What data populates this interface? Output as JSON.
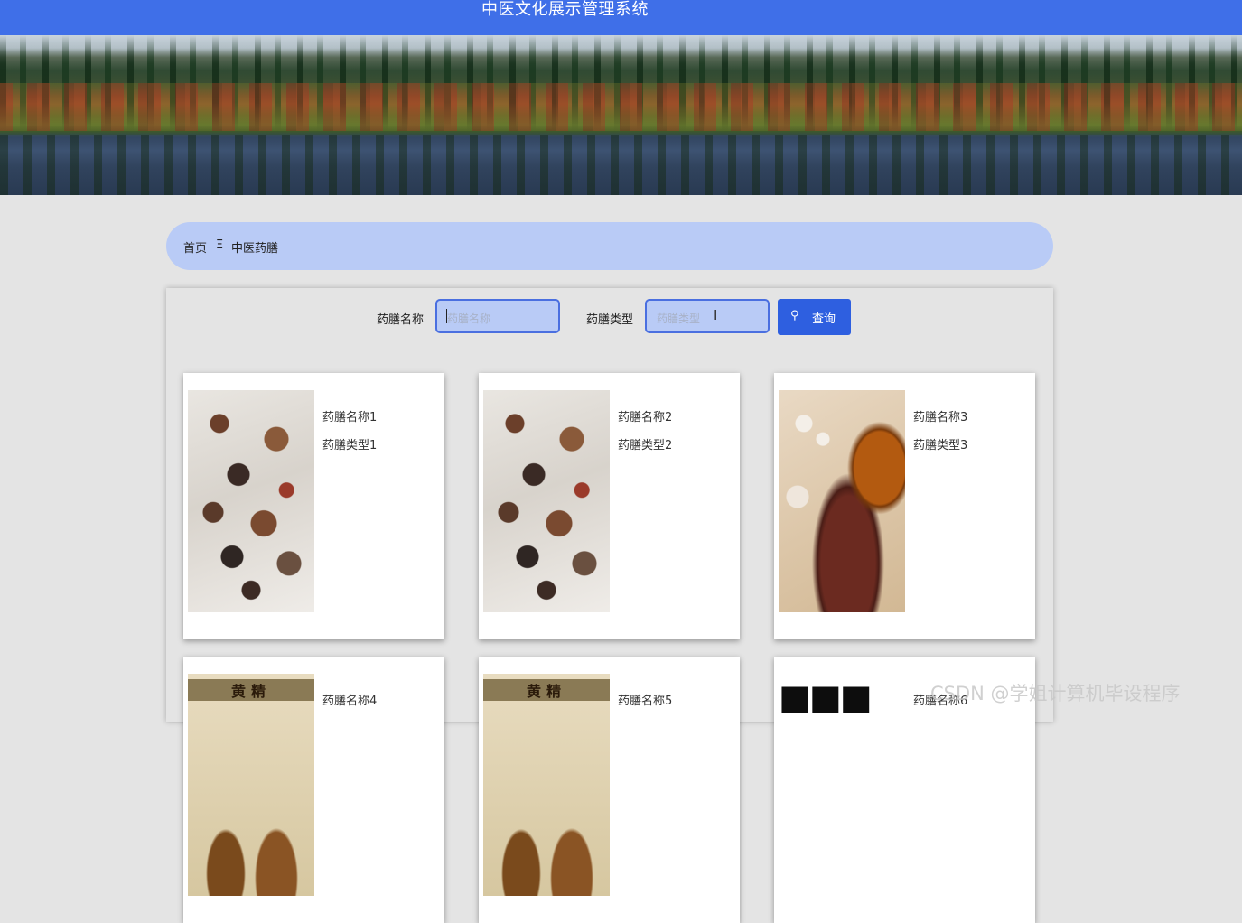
{
  "header": {
    "title": "中医文化展示管理系统"
  },
  "banner": {
    "active_slide": 2,
    "slide_count": 3
  },
  "breadcrumb": {
    "home": "首页",
    "separator": "Ξ",
    "current": "中医药膳"
  },
  "search": {
    "name_label": "药膳名称",
    "name_placeholder": "药膳名称",
    "type_label": "药膳类型",
    "type_placeholder": "药膳类型",
    "button_icon": "search-icon",
    "button_label": "查询"
  },
  "items": [
    {
      "name": "药膳名称1",
      "type": "药膳类型1",
      "image": "herbal-ingredients"
    },
    {
      "name": "药膳名称2",
      "type": "药膳类型2",
      "image": "herbal-ingredients"
    },
    {
      "name": "药膳名称3",
      "type": "药膳类型3",
      "image": "herbal-pot"
    },
    {
      "name": "药膳名称4",
      "image": "huangjing-label",
      "image_text": "黄精"
    },
    {
      "name": "药膳名称5",
      "image": "huangjing-label",
      "image_text": "黄精"
    },
    {
      "name": "药膳名称6",
      "image": "black-text"
    }
  ],
  "colors": {
    "topbar": "#3f6fe8",
    "breadcrumb_bg": "#b9cbf6",
    "button": "#2e5fe0",
    "page_bg": "#e4e4e4"
  },
  "watermark": "CSDN @学姐计算机毕设程序"
}
